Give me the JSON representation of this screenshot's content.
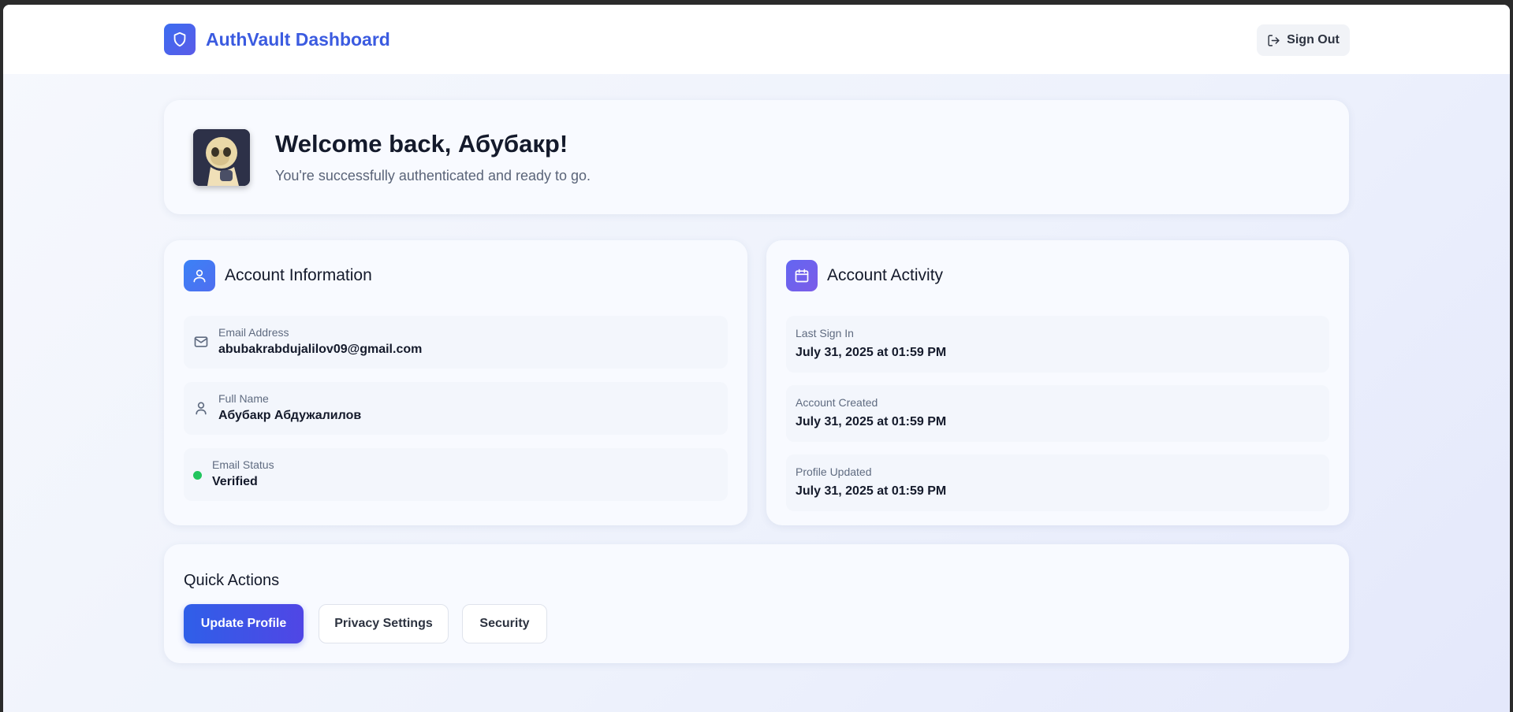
{
  "header": {
    "title": "AuthVault Dashboard",
    "logo_icon": "shield-icon",
    "sign_out_label": "Sign Out",
    "sign_out_icon": "log-out-icon"
  },
  "welcome": {
    "title": "Welcome back, Абубакр!",
    "subtitle": "You're successfully authenticated and ready to go.",
    "avatar_icon": "user-avatar"
  },
  "account_info": {
    "title": "Account Information",
    "icon": "user-icon",
    "fields": [
      {
        "label": "Email Address",
        "value": "abubakrabdujalilov09@gmail.com",
        "icon": "mail-icon"
      },
      {
        "label": "Full Name",
        "value": "Абубакр Абдужалилов",
        "icon": "user-icon"
      },
      {
        "label": "Email Status",
        "value": "Verified",
        "icon": "status-dot"
      }
    ]
  },
  "account_activity": {
    "title": "Account Activity",
    "icon": "calendar-icon",
    "items": [
      {
        "label": "Last Sign In",
        "value": "July 31, 2025 at 01:59 PM"
      },
      {
        "label": "Account Created",
        "value": "July 31, 2025 at 01:59 PM"
      },
      {
        "label": "Profile Updated",
        "value": "July 31, 2025 at 01:59 PM"
      }
    ]
  },
  "quick_actions": {
    "title": "Quick Actions",
    "buttons": [
      "Update Profile",
      "Privacy Settings",
      "Security"
    ]
  },
  "colors": {
    "brand": "#3b5be0",
    "primary_gradient_start": "#2f5fe8",
    "primary_gradient_end": "#5046e5",
    "verified": "#22c55e"
  }
}
